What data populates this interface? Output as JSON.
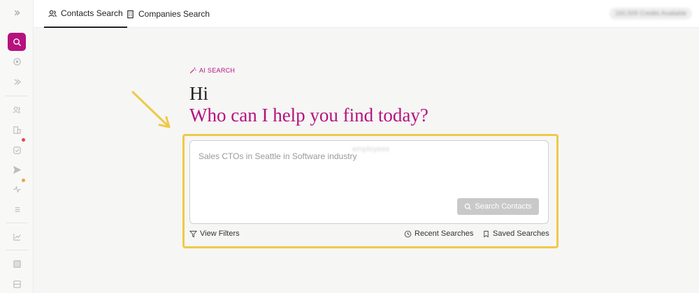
{
  "tabs": [
    {
      "label": "Contacts Search",
      "icon": "users-icon",
      "active": true
    },
    {
      "label": "Companies Search",
      "icon": "building-icon",
      "active": false
    }
  ],
  "credits": "160,509 Credits Available",
  "ai_label": "AI SEARCH",
  "greeting": "Hi",
  "subtitle": "Who can I help you find today?",
  "search": {
    "placeholder": "Sales CTOs in Seattle in Software industry",
    "ghost_text": "employees",
    "button_label": "Search Contacts"
  },
  "footer": {
    "view_filters": "View Filters",
    "recent_searches": "Recent Searches",
    "saved_searches": "Saved Searches"
  },
  "colors": {
    "accent": "#b5127e",
    "highlight": "#f0c94a",
    "notification_dot": "#e84545"
  }
}
